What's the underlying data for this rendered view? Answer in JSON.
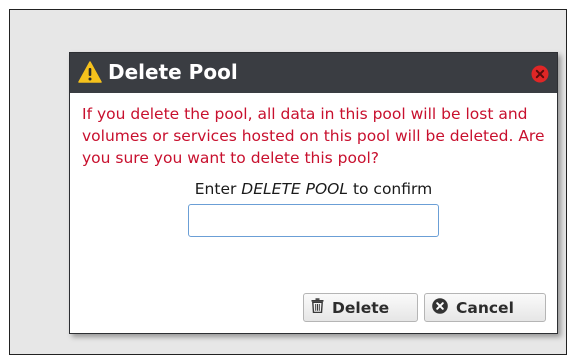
{
  "dialog": {
    "title": "Delete Pool",
    "message": "If you delete the pool, all data in this pool will be lost and volumes or services hosted on this pool will be deleted. Are you sure you want to delete this pool?",
    "confirm_prefix": "Enter ",
    "confirm_keyword": "DELETE POOL",
    "confirm_suffix": " to confirm",
    "input_value": "",
    "input_placeholder": "",
    "buttons": {
      "delete_label": "Delete",
      "cancel_label": "Cancel"
    }
  },
  "icons": {
    "title": "warning-icon",
    "close": "close-icon",
    "delete": "trash-icon",
    "cancel": "cancel-icon"
  },
  "colors": {
    "title_bar": "#3a3d42",
    "warning": "#f6c21c",
    "message_text": "#c8102e",
    "close": "#e02626",
    "input_border": "#6b9fd6",
    "backdrop": "#e7e7e7"
  }
}
